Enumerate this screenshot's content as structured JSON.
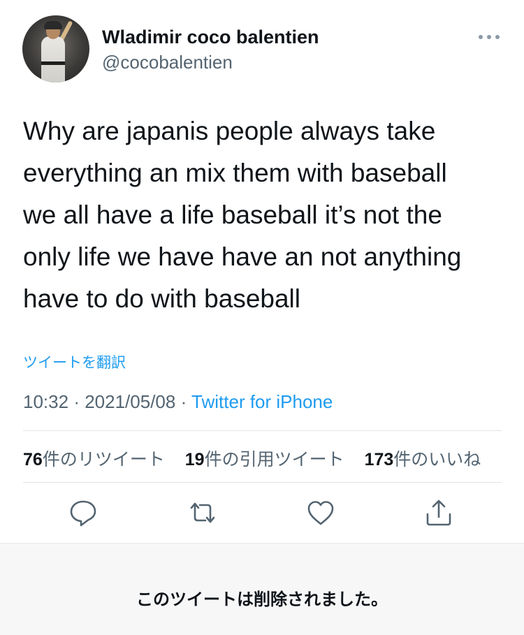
{
  "profile": {
    "display_name": "Wladimir coco balentien",
    "handle": "@cocobalentien",
    "avatar_icon": "baseball-player-avatar"
  },
  "tweet": {
    "text": "Why are japanis people always take\neverything an mix them with baseball\nwe all have a life baseball it’s not the\nonly life we have have an not anything\nhave to do with baseball",
    "translate_label": "ツイートを翻訳",
    "time": "10:32",
    "date": "2021/05/08",
    "separator": "·",
    "source": "Twitter for iPhone"
  },
  "stats": {
    "retweets": {
      "count": "76",
      "label": "件のリツイート"
    },
    "quotes": {
      "count": "19",
      "label": "件の引用ツイート"
    },
    "likes": {
      "count": "173",
      "label": "件のいいね"
    }
  },
  "actions": [
    "reply-icon",
    "retweet-icon",
    "like-icon",
    "share-icon"
  ],
  "notice": {
    "deleted_text": "このツイートは削除されました。"
  },
  "colors": {
    "link": "#1d9bf0",
    "secondary_text": "#536471",
    "primary_text": "#0f1419",
    "notice_background": "#f7f7f8"
  }
}
